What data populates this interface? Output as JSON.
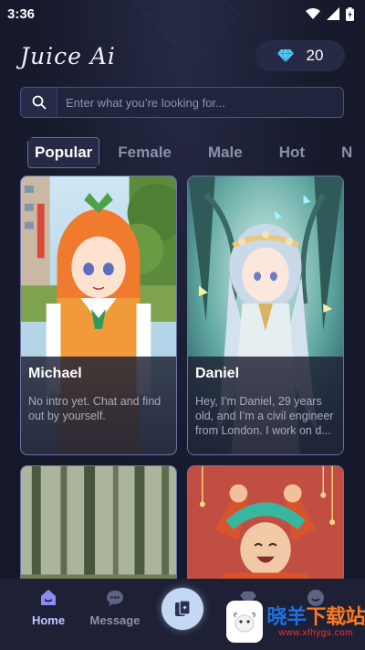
{
  "status_bar": {
    "time": "3:36"
  },
  "header": {
    "logo": "Juice Ai",
    "gem_count": "20",
    "gem_icon": "diamond-icon"
  },
  "search": {
    "placeholder": "Enter what you’re looking for..."
  },
  "tabs": [
    {
      "label": "Popular",
      "active": true
    },
    {
      "label": "Female"
    },
    {
      "label": "Male"
    },
    {
      "label": "Hot"
    },
    {
      "label": "N"
    }
  ],
  "cards": [
    {
      "name": "Michael",
      "description": "No intro yet. Chat and find out by yourself."
    },
    {
      "name": "Daniel",
      "description": "Hey, I’m Daniel, 29 years old, and I’m a civil engineer from London. I work on d..."
    },
    {
      "name": "",
      "description": ""
    },
    {
      "name": "",
      "description": ""
    }
  ],
  "bottom_nav": {
    "items": [
      {
        "label": "Home",
        "icon": "home-icon",
        "active": true
      },
      {
        "label": "Message",
        "icon": "message-icon"
      },
      {
        "label": "",
        "icon": "cards-icon"
      },
      {
        "label": "",
        "icon": "gem-icon"
      },
      {
        "label": "",
        "icon": "profile-icon"
      }
    ]
  },
  "watermark": {
    "text_a": "晓羊",
    "text_b": "下载站",
    "url": "www.xfhygs.com"
  },
  "colors": {
    "background": "#171a2d",
    "accent": "#c4c4ff",
    "card_border": "#6e72a8"
  }
}
